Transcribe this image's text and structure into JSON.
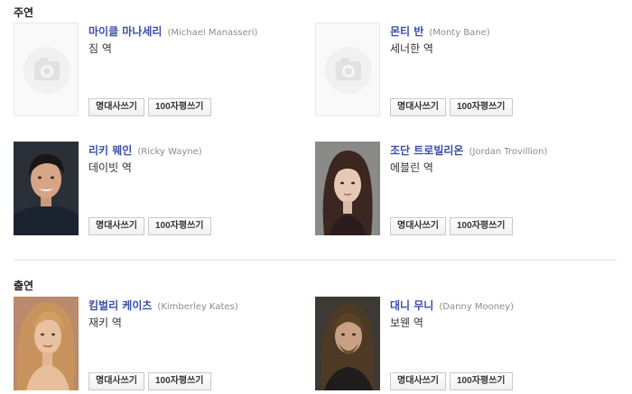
{
  "sections": [
    {
      "title": "주연",
      "cast": [
        {
          "name_ko": "마이클 마나세리",
          "name_en": "(Michael Manasseri)",
          "role": "짐 역",
          "photo": "placeholder"
        },
        {
          "name_ko": "몬티 반",
          "name_en": "(Monty Bane)",
          "role": "세너한 역",
          "photo": "placeholder"
        },
        {
          "name_ko": "리키 웨인",
          "name_en": "(Ricky Wayne)",
          "role": "데이빗 역",
          "photo": "dark-hair-man"
        },
        {
          "name_ko": "조단 트로빌리온",
          "name_en": "(Jordan Trovillion)",
          "role": "에블린 역",
          "photo": "brunette-woman"
        }
      ]
    },
    {
      "title": "출연",
      "cast": [
        {
          "name_ko": "킴벌리 케이츠",
          "name_en": "(Kimberley Kates)",
          "role": "재키 역",
          "photo": "blonde-woman"
        },
        {
          "name_ko": "대니 무니",
          "name_en": "(Danny Mooney)",
          "role": "보웬 역",
          "photo": "long-hair-man"
        }
      ]
    }
  ],
  "buttons": {
    "quote": "명대사쓰기",
    "review": "100자평쓰기"
  },
  "colors": {
    "name": "#3a4ea8",
    "english_name": "#8c8c8c",
    "divider": "#dddddd",
    "placeholder_bg": "#f9f9f9"
  }
}
